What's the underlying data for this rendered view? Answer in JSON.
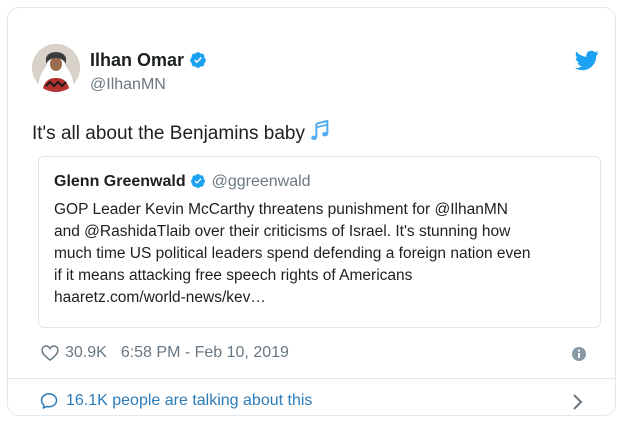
{
  "tweet": {
    "author_name": "Ilhan Omar",
    "author_handle": "@IlhanMN",
    "text": "It's all about the Benjamins baby",
    "text_emoji": "multiple-musical-notes",
    "likes": "30.9K",
    "timestamp": "6:58 PM - Feb 10, 2019",
    "talking": "16.1K people are talking about this"
  },
  "quote": {
    "author_name": "Glenn Greenwald",
    "author_handle": "@ggreenwald",
    "lines": [
      "GOP Leader Kevin McCarthy threatens punishment for @IlhanMN",
      "and @RashidaTlaib over their criticisms of Israel. It's stunning how",
      "much time US political leaders spend defending a foreign nation even",
      "if it means attacking free speech rights of Americans",
      "haaretz.com/world-news/kev…"
    ]
  },
  "icons": {
    "twitter": "twitter-bird-icon",
    "verified": "verified-badge-icon",
    "like": "heart-icon",
    "info": "info-icon",
    "reply": "speech-bubble-icon",
    "more": "chevron-right-icon"
  },
  "colors": {
    "twitter_blue": "#1da1f2",
    "link_blue": "#2b7bb9",
    "muted": "#697882",
    "border": "#e1e8ed"
  }
}
